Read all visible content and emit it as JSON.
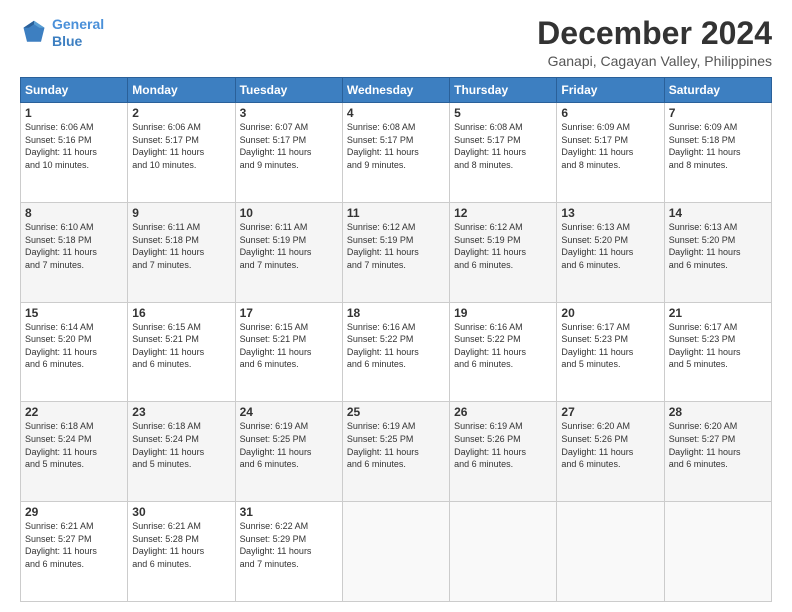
{
  "logo": {
    "line1": "General",
    "line2": "Blue"
  },
  "title": "December 2024",
  "subtitle": "Ganapi, Cagayan Valley, Philippines",
  "header_days": [
    "Sunday",
    "Monday",
    "Tuesday",
    "Wednesday",
    "Thursday",
    "Friday",
    "Saturday"
  ],
  "weeks": [
    [
      {
        "day": "1",
        "info": "Sunrise: 6:06 AM\nSunset: 5:16 PM\nDaylight: 11 hours\nand 10 minutes."
      },
      {
        "day": "2",
        "info": "Sunrise: 6:06 AM\nSunset: 5:17 PM\nDaylight: 11 hours\nand 10 minutes."
      },
      {
        "day": "3",
        "info": "Sunrise: 6:07 AM\nSunset: 5:17 PM\nDaylight: 11 hours\nand 9 minutes."
      },
      {
        "day": "4",
        "info": "Sunrise: 6:08 AM\nSunset: 5:17 PM\nDaylight: 11 hours\nand 9 minutes."
      },
      {
        "day": "5",
        "info": "Sunrise: 6:08 AM\nSunset: 5:17 PM\nDaylight: 11 hours\nand 8 minutes."
      },
      {
        "day": "6",
        "info": "Sunrise: 6:09 AM\nSunset: 5:17 PM\nDaylight: 11 hours\nand 8 minutes."
      },
      {
        "day": "7",
        "info": "Sunrise: 6:09 AM\nSunset: 5:18 PM\nDaylight: 11 hours\nand 8 minutes."
      }
    ],
    [
      {
        "day": "8",
        "info": "Sunrise: 6:10 AM\nSunset: 5:18 PM\nDaylight: 11 hours\nand 7 minutes."
      },
      {
        "day": "9",
        "info": "Sunrise: 6:11 AM\nSunset: 5:18 PM\nDaylight: 11 hours\nand 7 minutes."
      },
      {
        "day": "10",
        "info": "Sunrise: 6:11 AM\nSunset: 5:19 PM\nDaylight: 11 hours\nand 7 minutes."
      },
      {
        "day": "11",
        "info": "Sunrise: 6:12 AM\nSunset: 5:19 PM\nDaylight: 11 hours\nand 7 minutes."
      },
      {
        "day": "12",
        "info": "Sunrise: 6:12 AM\nSunset: 5:19 PM\nDaylight: 11 hours\nand 6 minutes."
      },
      {
        "day": "13",
        "info": "Sunrise: 6:13 AM\nSunset: 5:20 PM\nDaylight: 11 hours\nand 6 minutes."
      },
      {
        "day": "14",
        "info": "Sunrise: 6:13 AM\nSunset: 5:20 PM\nDaylight: 11 hours\nand 6 minutes."
      }
    ],
    [
      {
        "day": "15",
        "info": "Sunrise: 6:14 AM\nSunset: 5:20 PM\nDaylight: 11 hours\nand 6 minutes."
      },
      {
        "day": "16",
        "info": "Sunrise: 6:15 AM\nSunset: 5:21 PM\nDaylight: 11 hours\nand 6 minutes."
      },
      {
        "day": "17",
        "info": "Sunrise: 6:15 AM\nSunset: 5:21 PM\nDaylight: 11 hours\nand 6 minutes."
      },
      {
        "day": "18",
        "info": "Sunrise: 6:16 AM\nSunset: 5:22 PM\nDaylight: 11 hours\nand 6 minutes."
      },
      {
        "day": "19",
        "info": "Sunrise: 6:16 AM\nSunset: 5:22 PM\nDaylight: 11 hours\nand 6 minutes."
      },
      {
        "day": "20",
        "info": "Sunrise: 6:17 AM\nSunset: 5:23 PM\nDaylight: 11 hours\nand 5 minutes."
      },
      {
        "day": "21",
        "info": "Sunrise: 6:17 AM\nSunset: 5:23 PM\nDaylight: 11 hours\nand 5 minutes."
      }
    ],
    [
      {
        "day": "22",
        "info": "Sunrise: 6:18 AM\nSunset: 5:24 PM\nDaylight: 11 hours\nand 5 minutes."
      },
      {
        "day": "23",
        "info": "Sunrise: 6:18 AM\nSunset: 5:24 PM\nDaylight: 11 hours\nand 5 minutes."
      },
      {
        "day": "24",
        "info": "Sunrise: 6:19 AM\nSunset: 5:25 PM\nDaylight: 11 hours\nand 6 minutes."
      },
      {
        "day": "25",
        "info": "Sunrise: 6:19 AM\nSunset: 5:25 PM\nDaylight: 11 hours\nand 6 minutes."
      },
      {
        "day": "26",
        "info": "Sunrise: 6:19 AM\nSunset: 5:26 PM\nDaylight: 11 hours\nand 6 minutes."
      },
      {
        "day": "27",
        "info": "Sunrise: 6:20 AM\nSunset: 5:26 PM\nDaylight: 11 hours\nand 6 minutes."
      },
      {
        "day": "28",
        "info": "Sunrise: 6:20 AM\nSunset: 5:27 PM\nDaylight: 11 hours\nand 6 minutes."
      }
    ],
    [
      {
        "day": "29",
        "info": "Sunrise: 6:21 AM\nSunset: 5:27 PM\nDaylight: 11 hours\nand 6 minutes."
      },
      {
        "day": "30",
        "info": "Sunrise: 6:21 AM\nSunset: 5:28 PM\nDaylight: 11 hours\nand 6 minutes."
      },
      {
        "day": "31",
        "info": "Sunrise: 6:22 AM\nSunset: 5:29 PM\nDaylight: 11 hours\nand 7 minutes."
      },
      {
        "day": "",
        "info": ""
      },
      {
        "day": "",
        "info": ""
      },
      {
        "day": "",
        "info": ""
      },
      {
        "day": "",
        "info": ""
      }
    ]
  ]
}
